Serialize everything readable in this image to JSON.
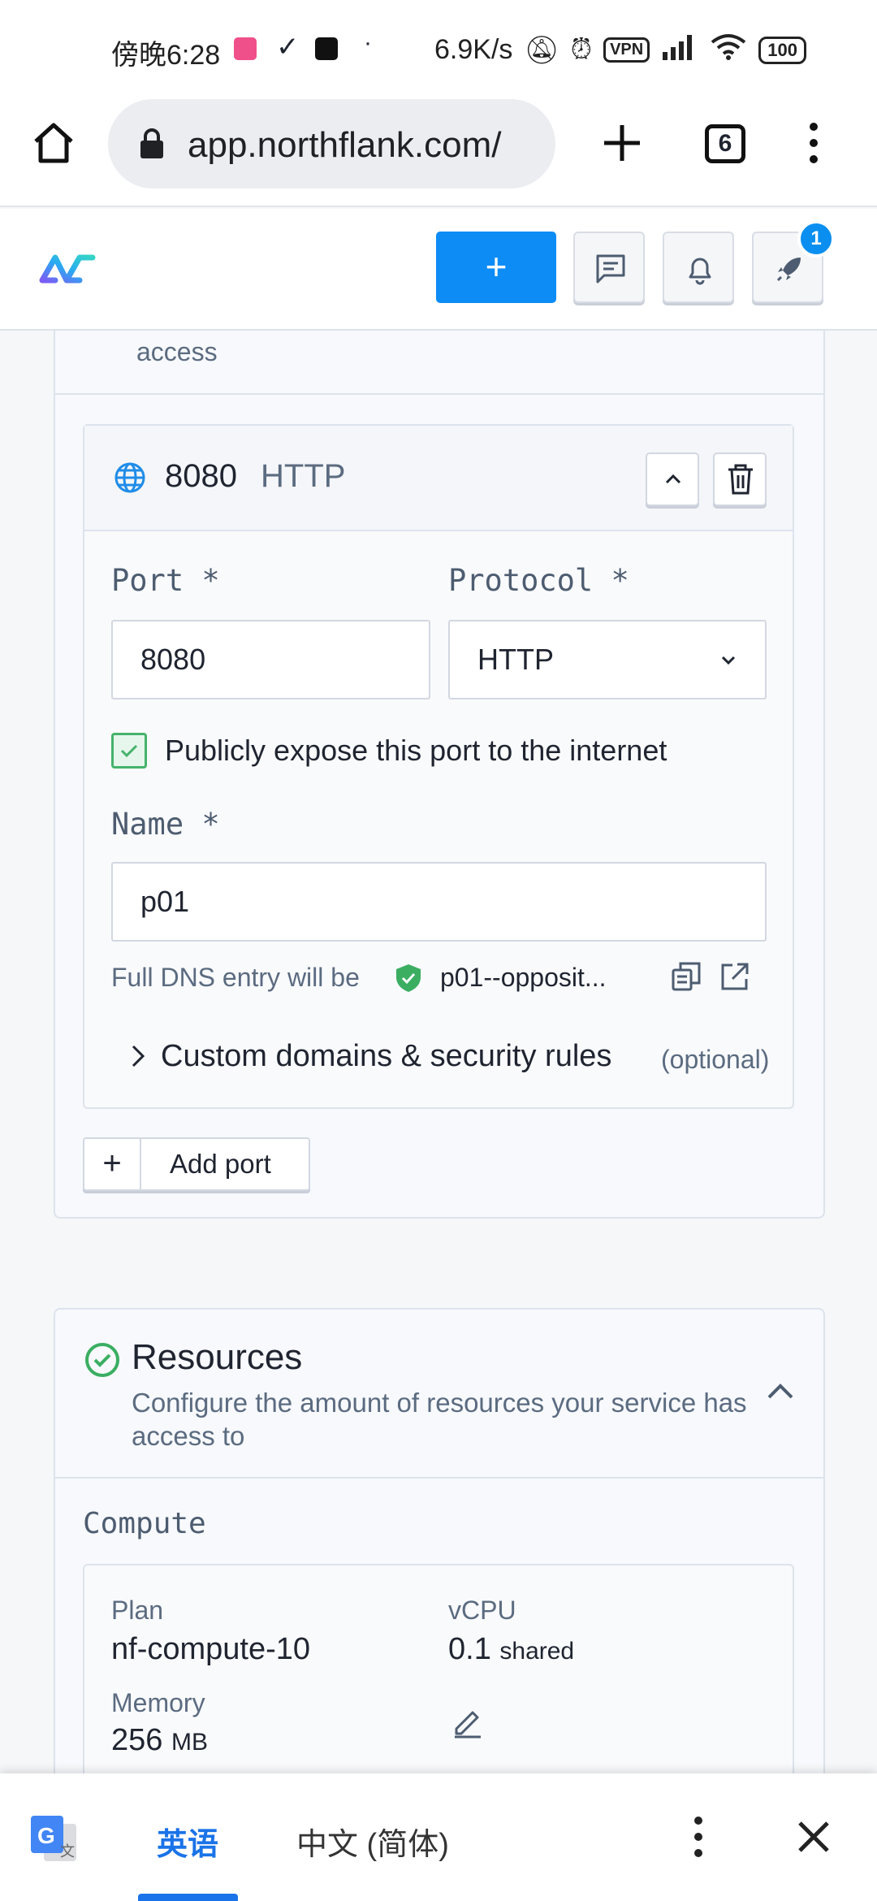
{
  "status_bar": {
    "time": "傍晚6:28",
    "net_speed": "6.9K/s",
    "vpn": "VPN",
    "battery": "100"
  },
  "browser": {
    "url": "app.northflank.com/",
    "tab_count": "6"
  },
  "header": {
    "notification_badge": "1",
    "accent_color": "#0d8cf6"
  },
  "networking": {
    "truncated_desc": "access"
  },
  "port": {
    "number": "8080",
    "protocol": "HTTP",
    "port_label": "Port *",
    "port_value": "8080",
    "protocol_label": "Protocol *",
    "protocol_value": "HTTP",
    "expose_label": "Publicly expose this port to the internet",
    "expose_checked": true,
    "name_label": "Name *",
    "name_value": "p01",
    "dns_label": "Full DNS entry will be",
    "dns_value": "p01--opposit...",
    "custom_domains_label": "Custom domains & security rules",
    "optional_label": "(optional)"
  },
  "add_port_label": "Add port",
  "resources": {
    "title": "Resources",
    "description": "Configure the amount of resources your service has access to",
    "compute_label": "Compute",
    "plan_label": "Plan",
    "plan_value": "nf-compute-10",
    "vcpu_label": "vCPU",
    "vcpu_value": "0.1",
    "vcpu_unit": "shared",
    "memory_label": "Memory",
    "memory_value": "256",
    "memory_unit": "MB"
  },
  "translate_bar": {
    "source_lang": "英语",
    "target_lang": "中文 (简体)"
  }
}
